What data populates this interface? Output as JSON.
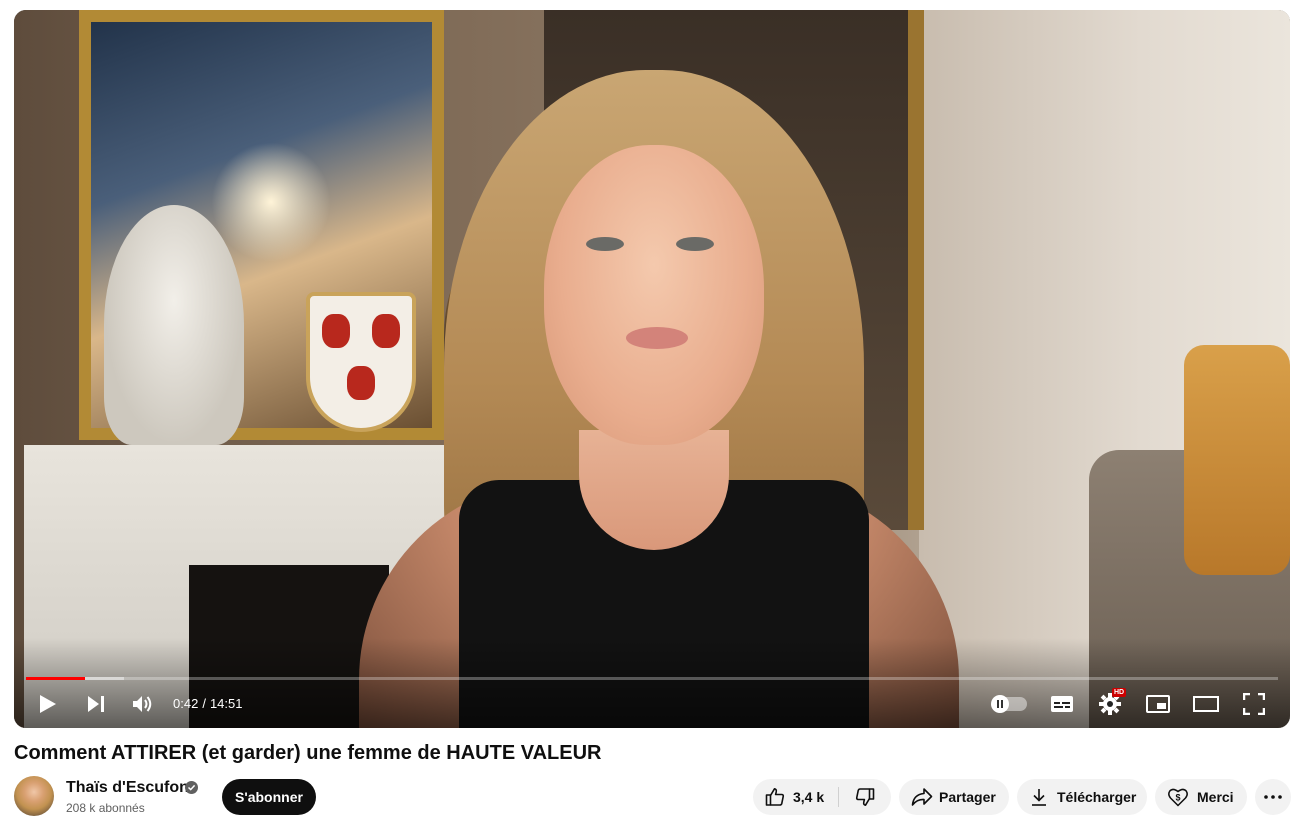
{
  "player": {
    "current_time": "0:42",
    "duration": "14:51",
    "time_separator": "/",
    "progress_played_fraction": 0.047,
    "progress_buffered_fraction": 0.078,
    "hd_badge": "HD",
    "accent_color": "#ff0000",
    "controls": [
      "play-icon",
      "next-icon",
      "volume-icon",
      "autoplay-toggle",
      "subtitles-icon",
      "settings-icon",
      "miniplayer-icon",
      "theater-icon",
      "fullscreen-icon"
    ]
  },
  "video": {
    "title": "Comment ATTIRER (et garder) une femme de HAUTE VALEUR"
  },
  "channel": {
    "name": "Thaïs d'Escufon",
    "subscribers": "208 k abonnés",
    "verified": true,
    "subscribe_label": "S'abonner"
  },
  "actions": {
    "like_count": "3,4 k",
    "share_label": "Partager",
    "download_label": "Télécharger",
    "thanks_label": "Merci"
  }
}
